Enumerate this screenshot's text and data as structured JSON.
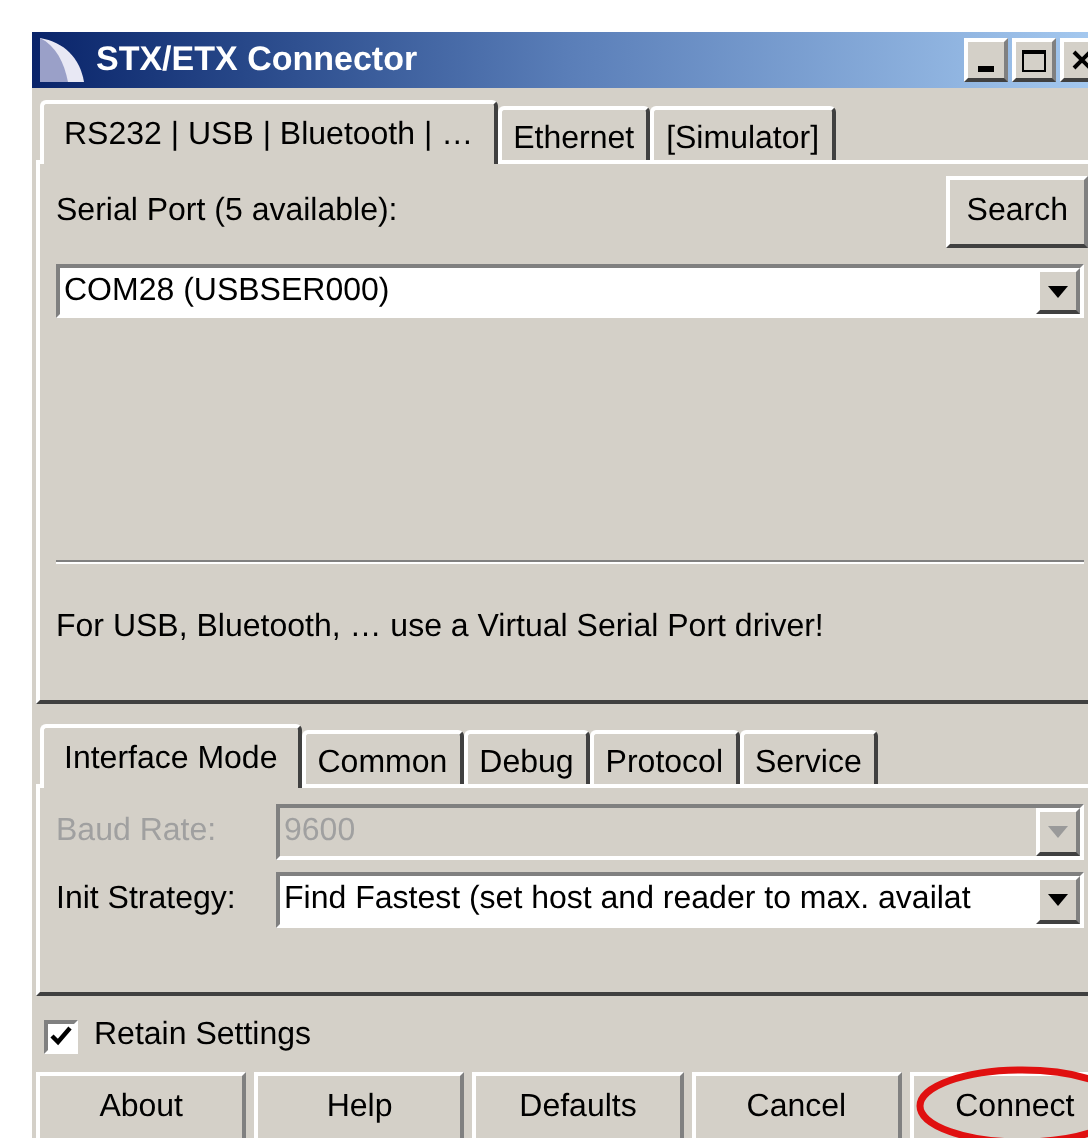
{
  "window": {
    "title": "STX/ETX Connector"
  },
  "connection_tabs": [
    {
      "label": "RS232 | USB | Bluetooth | …",
      "selected": true
    },
    {
      "label": "Ethernet",
      "selected": false
    },
    {
      "label": "[Simulator]",
      "selected": false
    }
  ],
  "serial_port": {
    "label": "Serial Port (5 available):",
    "search_button": "Search",
    "value": "COM28 (USBSER000)"
  },
  "hint": "For USB, Bluetooth, … use a Virtual Serial Port driver!",
  "settings_tabs": [
    {
      "label": "Interface Mode",
      "selected": true
    },
    {
      "label": "Common",
      "selected": false
    },
    {
      "label": "Debug",
      "selected": false
    },
    {
      "label": "Protocol",
      "selected": false
    },
    {
      "label": "Service",
      "selected": false
    }
  ],
  "fields": [
    {
      "label": "Baud Rate:",
      "value": "9600",
      "disabled": true
    },
    {
      "label": "Init Strategy:",
      "value": "Find Fastest (set host and reader to max. availat",
      "disabled": false
    }
  ],
  "retain_settings": {
    "label": "Retain Settings",
    "checked": true
  },
  "buttons": [
    {
      "label": "About",
      "highlighted": false
    },
    {
      "label": "Help",
      "highlighted": false
    },
    {
      "label": "Defaults",
      "highlighted": false
    },
    {
      "label": "Cancel",
      "highlighted": false
    },
    {
      "label": "Connect",
      "highlighted": true
    }
  ]
}
